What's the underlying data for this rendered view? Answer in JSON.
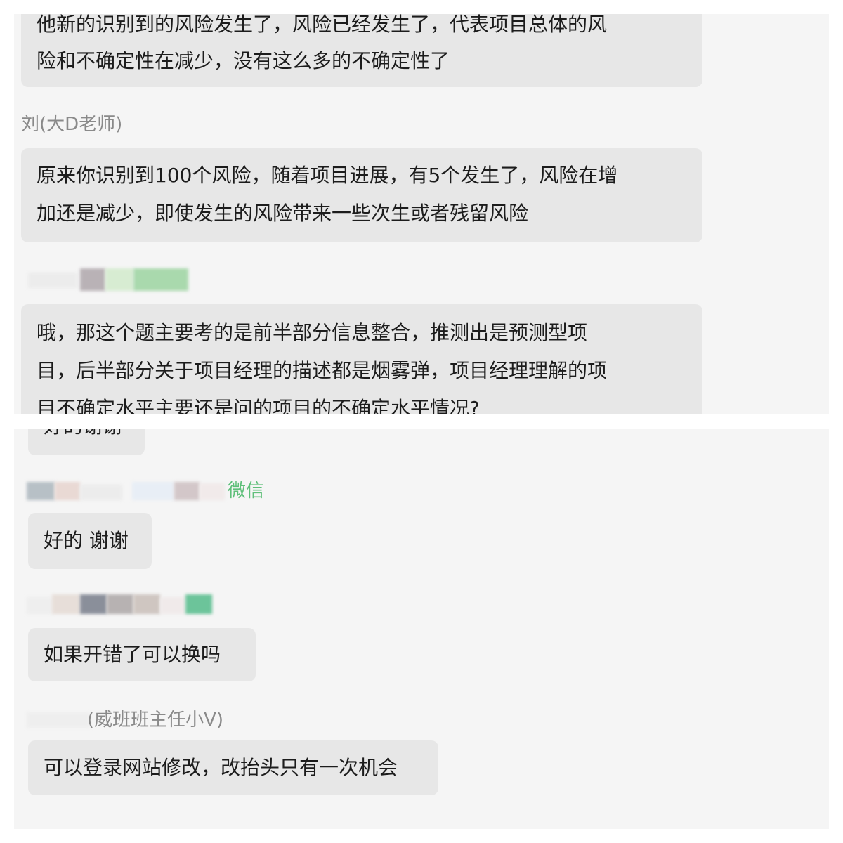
{
  "chat_top": {
    "message_1": {
      "lines": [
        "他新的识别到的风险发生了，风险已经发生了，代表项目总体的风",
        "险和不确定性在减少，没有这么多的不确定性了"
      ]
    },
    "message_2": {
      "sender": "刘(大D老师)",
      "lines": [
        "原来你识别到100个风险，随着项目进展，有5个发生了，风险在增",
        "加还是减少，即使发生的风险带来一些次生或者残留风险"
      ]
    },
    "message_3": {
      "lines": [
        "哦，那这个题主要考的是前半部分信息整合，推测出是预测型项",
        "目，后半部分关于项目经理的描述都是烟雾弹，项目经理理解的项",
        "目不确定水平主要还是问的项目的不确定水平情况?"
      ]
    }
  },
  "chat_bottom": {
    "message_1": {
      "text": "好的谢谢"
    },
    "message_2": {
      "sender_suffix": "微信",
      "text": "好的 谢谢"
    },
    "message_3": {
      "text": "如果开错了可以换吗"
    },
    "message_4": {
      "sender": "(威班班主任小V)",
      "text": "可以登录网站修改，改抬头只有一次机会"
    }
  },
  "colors": {
    "panel_bg": "#f5f5f5",
    "bubble_bg": "#e7e7e7",
    "sender_gray": "#8a8a8a",
    "wechat_green": "#5fbf7a"
  }
}
